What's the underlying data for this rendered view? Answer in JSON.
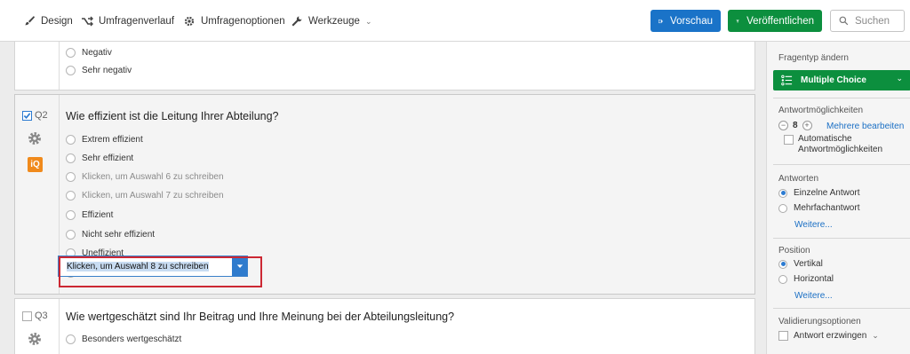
{
  "toolbar": {
    "design": "Design",
    "history": "Umfragenverlauf",
    "options": "Umfragenoptionen",
    "tools": "Werkzeuge",
    "preview": "Vorschau",
    "publish": "Veröffentlichen",
    "search_placeholder": "Suchen",
    "accent_blue": "#1a73c8",
    "accent_green": "#0c8f3e"
  },
  "previous_question": {
    "choices": [
      "Negativ",
      "Sehr negativ"
    ]
  },
  "q2": {
    "number": "Q2",
    "selected": true,
    "text": "Wie effizient ist die Leitung Ihrer Abteilung?",
    "badge": "iQ",
    "choices": [
      {
        "label": "Extrem effizient",
        "placeholder": false
      },
      {
        "label": "Sehr effizient",
        "placeholder": false
      },
      {
        "label": "Klicken, um Auswahl 6 zu schreiben",
        "placeholder": true
      },
      {
        "label": "Klicken, um Auswahl 7 zu schreiben",
        "placeholder": true
      },
      {
        "label": "Effizient",
        "placeholder": false
      },
      {
        "label": "Nicht sehr effizient",
        "placeholder": false
      },
      {
        "label": "Uneffizient",
        "placeholder": false
      }
    ],
    "editing_choice": "Klicken, um Auswahl 8 zu schreiben"
  },
  "q3": {
    "number": "Q3",
    "selected": false,
    "text": "Wie wertgeschätzt sind Ihr Beitrag und Ihre Meinung bei der Abteilungsleitung?",
    "choices": [
      "Besonders wertgeschätzt"
    ]
  },
  "panel": {
    "question_type_title": "Fragentyp ändern",
    "question_type": "Multiple Choice",
    "answer_choices_title": "Antwortmöglichkeiten",
    "choice_count": "8",
    "edit_multiple": "Mehrere bearbeiten",
    "auto_choices_line1": "Automatische",
    "auto_choices_line2": "Antwortmöglichkeiten",
    "answers_title": "Antworten",
    "single_answer": "Einzelne Antwort",
    "multiple_answer": "Mehrfachantwort",
    "more_1": "Weitere...",
    "position_title": "Position",
    "vertical": "Vertikal",
    "horizontal": "Horizontal",
    "more_2": "Weitere...",
    "validation_title": "Validierungsoptionen",
    "force_response": "Antwort erzwingen"
  }
}
